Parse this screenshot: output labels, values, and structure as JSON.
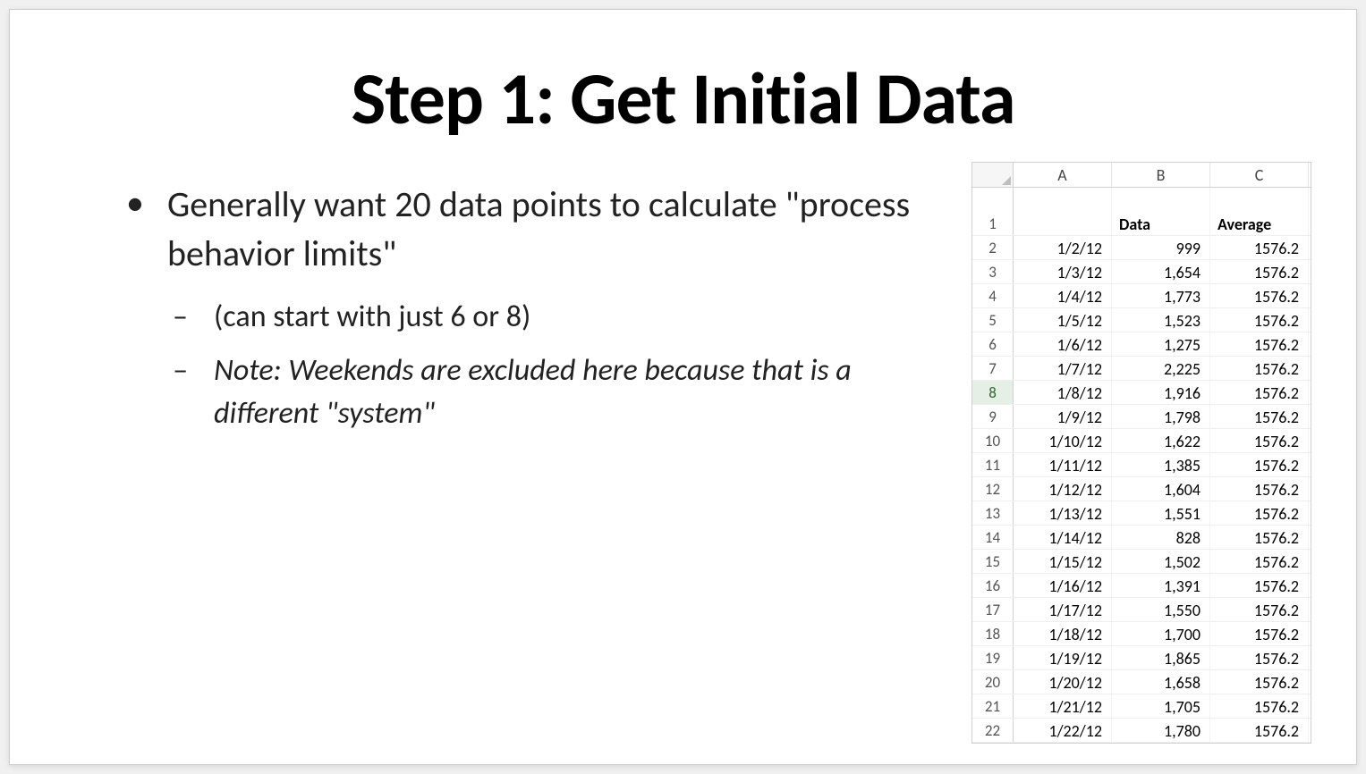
{
  "slide": {
    "title": "Step 1: Get Initial Data",
    "bullets": {
      "main": "Generally want 20 data points to calculate \"process behavior limits\"",
      "sub1": "(can start with just 6 or 8)",
      "sub2": "Note: Weekends are excluded here because that is a different \"system\""
    }
  },
  "sheet": {
    "col_headers": [
      "A",
      "B",
      "C"
    ],
    "row1": {
      "b": "Data",
      "c": "Average"
    },
    "selected_row": 8,
    "rows": [
      {
        "n": 2,
        "a": "1/2/12",
        "b": "999",
        "c": "1576.2"
      },
      {
        "n": 3,
        "a": "1/3/12",
        "b": "1,654",
        "c": "1576.2"
      },
      {
        "n": 4,
        "a": "1/4/12",
        "b": "1,773",
        "c": "1576.2"
      },
      {
        "n": 5,
        "a": "1/5/12",
        "b": "1,523",
        "c": "1576.2"
      },
      {
        "n": 6,
        "a": "1/6/12",
        "b": "1,275",
        "c": "1576.2"
      },
      {
        "n": 7,
        "a": "1/7/12",
        "b": "2,225",
        "c": "1576.2"
      },
      {
        "n": 8,
        "a": "1/8/12",
        "b": "1,916",
        "c": "1576.2"
      },
      {
        "n": 9,
        "a": "1/9/12",
        "b": "1,798",
        "c": "1576.2"
      },
      {
        "n": 10,
        "a": "1/10/12",
        "b": "1,622",
        "c": "1576.2"
      },
      {
        "n": 11,
        "a": "1/11/12",
        "b": "1,385",
        "c": "1576.2"
      },
      {
        "n": 12,
        "a": "1/12/12",
        "b": "1,604",
        "c": "1576.2"
      },
      {
        "n": 13,
        "a": "1/13/12",
        "b": "1,551",
        "c": "1576.2"
      },
      {
        "n": 14,
        "a": "1/14/12",
        "b": "828",
        "c": "1576.2"
      },
      {
        "n": 15,
        "a": "1/15/12",
        "b": "1,502",
        "c": "1576.2"
      },
      {
        "n": 16,
        "a": "1/16/12",
        "b": "1,391",
        "c": "1576.2"
      },
      {
        "n": 17,
        "a": "1/17/12",
        "b": "1,550",
        "c": "1576.2"
      },
      {
        "n": 18,
        "a": "1/18/12",
        "b": "1,700",
        "c": "1576.2"
      },
      {
        "n": 19,
        "a": "1/19/12",
        "b": "1,865",
        "c": "1576.2"
      },
      {
        "n": 20,
        "a": "1/20/12",
        "b": "1,658",
        "c": "1576.2"
      },
      {
        "n": 21,
        "a": "1/21/12",
        "b": "1,705",
        "c": "1576.2"
      },
      {
        "n": 22,
        "a": "1/22/12",
        "b": "1,780",
        "c": "1576.2"
      }
    ]
  }
}
